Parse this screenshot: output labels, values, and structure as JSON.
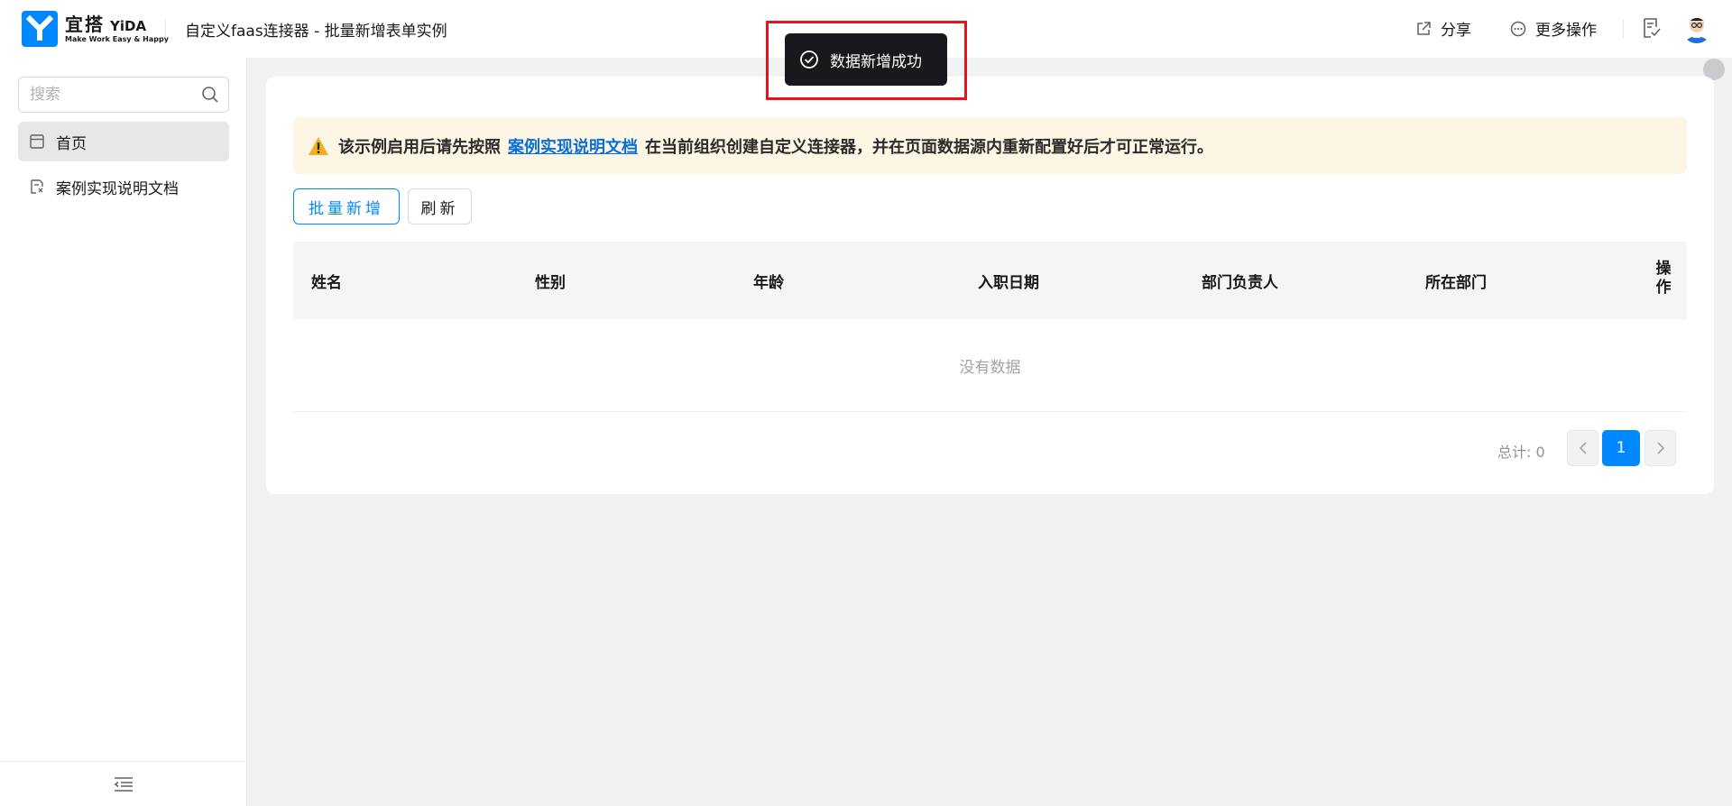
{
  "header": {
    "logo_cn": "宜搭",
    "logo_en": "YiDA",
    "logo_slogan": "Make Work Easy & Happy",
    "app_title": "自定义faas连接器 - 批量新增表单实例",
    "share_label": "分享",
    "more_label": "更多操作"
  },
  "sidebar": {
    "search_placeholder": "搜索",
    "items": [
      {
        "label": "首页",
        "icon": "page-icon",
        "active": true
      },
      {
        "label": "案例实现说明文档",
        "icon": "doc-link-icon",
        "active": false
      }
    ]
  },
  "main": {
    "alert": {
      "prefix": "该示例启用后请先按照",
      "link": "案例实现说明文档",
      "suffix": "在当前组织创建自定义连接器，并在页面数据源内重新配置好后才可正常运行。"
    },
    "buttons": {
      "batch_add": "批量新增",
      "refresh": "刷新"
    },
    "table": {
      "columns": [
        "姓名",
        "性别",
        "年龄",
        "入职日期",
        "部门负责人",
        "所在部门",
        "操作"
      ],
      "empty_text": "没有数据"
    },
    "pagination": {
      "total_label": "总计: 0",
      "current_page": "1"
    }
  },
  "toast": {
    "message": "数据新增成功",
    "icon": "check-circle-icon"
  },
  "colors": {
    "primary": "#0089ff",
    "toast_bg": "#17191c",
    "highlight": "#e8131a",
    "alert_bg": "#fdf6e4"
  }
}
